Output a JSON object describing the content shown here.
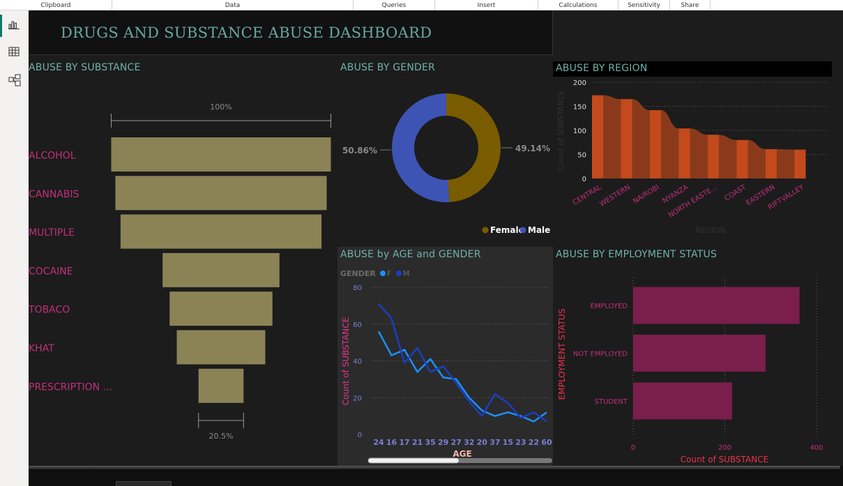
{
  "ribbon": {
    "groups": [
      "Clipboard",
      "Data",
      "Queries",
      "Insert",
      "Calculations",
      "Sensitivity",
      "Share"
    ]
  },
  "sidebar": {
    "items": [
      {
        "icon": "report-view-icon",
        "active": true
      },
      {
        "icon": "table-view-icon",
        "active": false
      },
      {
        "icon": "model-view-icon",
        "active": false
      }
    ]
  },
  "dashboard": {
    "title": "DRUGS AND SUBSTANCE ABUSE DASHBOARD"
  },
  "colors": {
    "canvas": "#1c1c1c",
    "funnel": "#8b8356",
    "female": "#7a5c00",
    "male": "#3d54b5",
    "region_bar": "#c24a1c",
    "region_ribbon": "#8a3a1a",
    "line_f": "#1e90ff",
    "line_m": "#1a3fbf",
    "employment_bar": "#7a1e4c",
    "label_magenta": "#c0307a",
    "label_red": "#e8334a"
  },
  "visuals": {
    "substance": {
      "title": "ABUSE BY SUBSTANCE"
    },
    "gender": {
      "title": "ABUSE BY GENDER"
    },
    "region": {
      "title": "ABUSE BY REGION"
    },
    "age_gender": {
      "title": "ABUSE by AGE and GENDER"
    },
    "employment": {
      "title": "ABUSE BY EMPLOYMENT STATUS"
    }
  },
  "chart_data": [
    {
      "id": "substance",
      "type": "bar",
      "subtype": "funnel",
      "title": "ABUSE BY SUBSTANCE",
      "categories": [
        "ALCOHOL",
        "CANNABIS",
        "MULTIPLE",
        "COCAINE",
        "TOBACO",
        "KHAT",
        "PRESCRIPTION ..."
      ],
      "values": [
        100,
        96.2,
        91.5,
        53.2,
        46.8,
        40.3,
        20.5
      ],
      "unit": "%",
      "top_label": "100%",
      "bottom_label": "20.5%"
    },
    {
      "id": "gender",
      "type": "pie",
      "subtype": "donut",
      "title": "ABUSE BY GENDER",
      "categories": [
        "Female",
        "Male"
      ],
      "values": [
        49.14,
        50.86
      ],
      "labels": [
        "49.14%",
        "50.86%"
      ],
      "legend": "bottom-right"
    },
    {
      "id": "region",
      "type": "bar",
      "subtype": "ribbon",
      "title": "ABUSE BY REGION",
      "categories": [
        "CENTRAL",
        "WESTERN",
        "NAIROBI",
        "NYANZA",
        "NORTH EASTE...",
        "COAST",
        "EASTERN",
        "RIFTVALLEY"
      ],
      "values": [
        173,
        165,
        142,
        104,
        91,
        80,
        61,
        60
      ],
      "xlabel": "REGION",
      "ylabel": "Count of SUBSTANCE",
      "ylim": [
        0,
        200
      ],
      "yticks": [
        0,
        50,
        100,
        150,
        200
      ],
      "grid": true
    },
    {
      "id": "age_gender",
      "type": "line",
      "title": "ABUSE by AGE and GENDER",
      "legend_title": "GENDER",
      "categories": [
        "24",
        "16",
        "17",
        "21",
        "35",
        "29",
        "27",
        "32",
        "20",
        "37",
        "15",
        "23",
        "22",
        "60"
      ],
      "series": [
        {
          "name": "F",
          "values": [
            56,
            43,
            46,
            34,
            41,
            31,
            30,
            20,
            13,
            10,
            12,
            10,
            7,
            12
          ]
        },
        {
          "name": "M",
          "values": [
            71,
            63,
            39,
            47,
            34,
            37,
            28,
            18,
            10,
            22,
            17,
            9,
            12,
            7
          ]
        }
      ],
      "xlabel": "AGE",
      "ylabel": "Count of SUBSTANCE",
      "ylim": [
        0,
        80
      ],
      "yticks": [
        0,
        20,
        40,
        60,
        80
      ],
      "legend": "top-left",
      "grid": true
    },
    {
      "id": "employment",
      "type": "bar",
      "subtype": "horizontal",
      "title": "ABUSE BY EMPLOYMENT STATUS",
      "categories": [
        "EMPLOYED",
        "NOT EMPLOYED",
        "STUDENT"
      ],
      "values": [
        363,
        289,
        216
      ],
      "xlabel": "Count of SUBSTANCE",
      "ylabel": "EMPLOYMENT STATUS",
      "xlim": [
        0,
        400
      ],
      "xticks": [
        0,
        200,
        400
      ],
      "grid": true
    }
  ]
}
